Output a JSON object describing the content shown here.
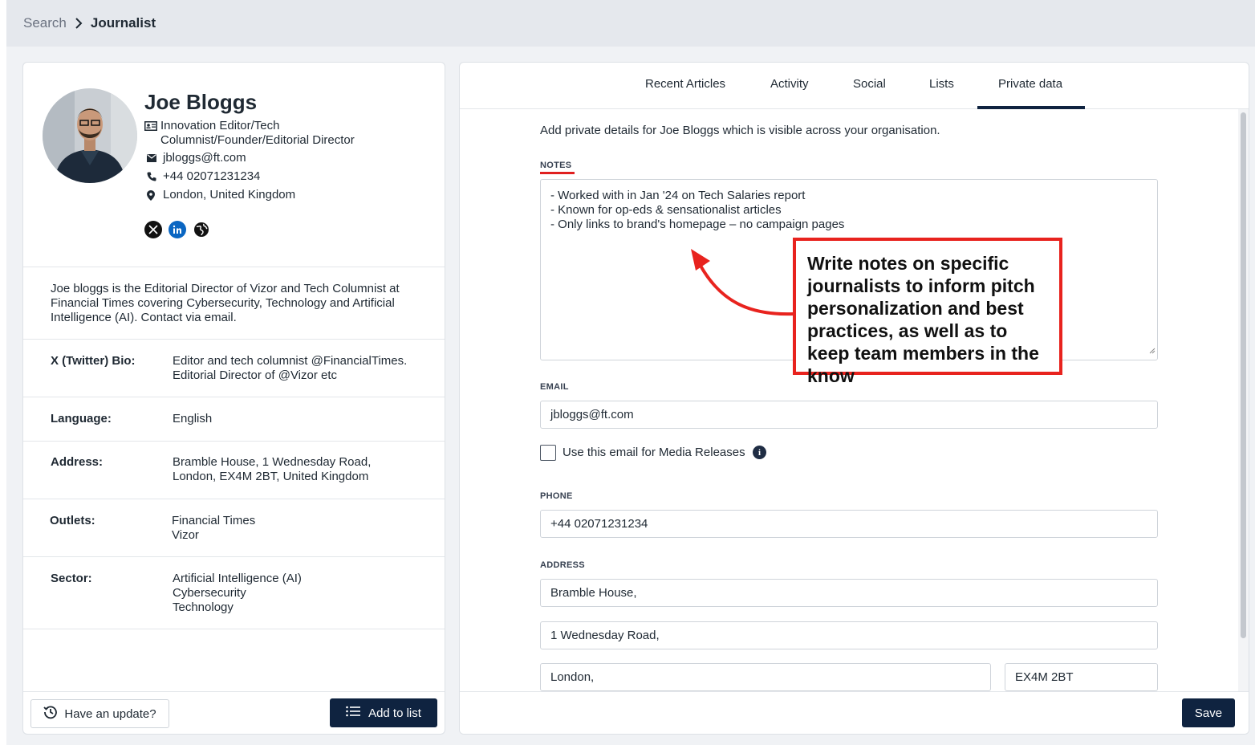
{
  "breadcrumb": {
    "parent": "Search",
    "current": "Journalist"
  },
  "profile": {
    "name": "Joe Bloggs",
    "role_line1": "Innovation Editor/Tech",
    "role_line2": "Columnist/Founder/Editorial Director",
    "email": "jbloggs@ft.com",
    "phone": "+44 02071231234",
    "location": "London, United Kingdom",
    "socials": [
      "x-icon",
      "linkedin-icon",
      "globe-icon"
    ],
    "bio": "Joe bloggs is the Editorial Director of Vizor and Tech Columnist at Financial Times covering Cybersecurity, Technology and Artificial Intelligence (AI). Contact via email."
  },
  "details": [
    {
      "label": "X (Twitter) Bio:",
      "value": "Editor and tech columnist @FinancialTimes.\nEditorial Director of @Vizor etc"
    },
    {
      "label": "Language:",
      "value": "English"
    },
    {
      "label": "Address:",
      "value": "Bramble House, 1 Wednesday Road,\nLondon, EX4M 2BT, United Kingdom"
    },
    {
      "label": "Outlets:",
      "value": "Financial Times\nVizor"
    },
    {
      "label": "Sector:",
      "value": "Artificial Intelligence (AI)\nCybersecurity\nTechnology"
    }
  ],
  "left_actions": {
    "update_label": "Have an update?",
    "add_list_label": "Add to list"
  },
  "tabs": [
    "Recent Articles",
    "Activity",
    "Social",
    "Lists",
    "Private data"
  ],
  "active_tab": "Private data",
  "private": {
    "intro": "Add private details for Joe Bloggs which is visible across your organisation.",
    "notes_label": "NOTES",
    "notes_lines": [
      "- Worked with in Jan '24 on Tech Salaries report",
      "- Known for op-eds & sensationalist articles",
      "- Only links to brand's homepage – no campaign pages"
    ],
    "email_label": "EMAIL",
    "email_value": "jbloggs@ft.com",
    "media_release_label": "Use this email for Media Releases",
    "media_release_checked": false,
    "phone_label": "PHONE",
    "phone_value": "+44 02071231234",
    "address_label": "ADDRESS",
    "address_line1": "Bramble House,",
    "address_line2": "1 Wednesday Road,",
    "address_city": "London,",
    "address_postcode": "EX4M 2BT",
    "save_label": "Save"
  },
  "annotation": {
    "callout_text": "Write notes on specific journalists to inform pitch personalization and best practices, as well as to keep team members in the know",
    "color": "#e8231e"
  },
  "colors": {
    "navy": "#0f2340",
    "linkedin": "#0a66c2"
  }
}
